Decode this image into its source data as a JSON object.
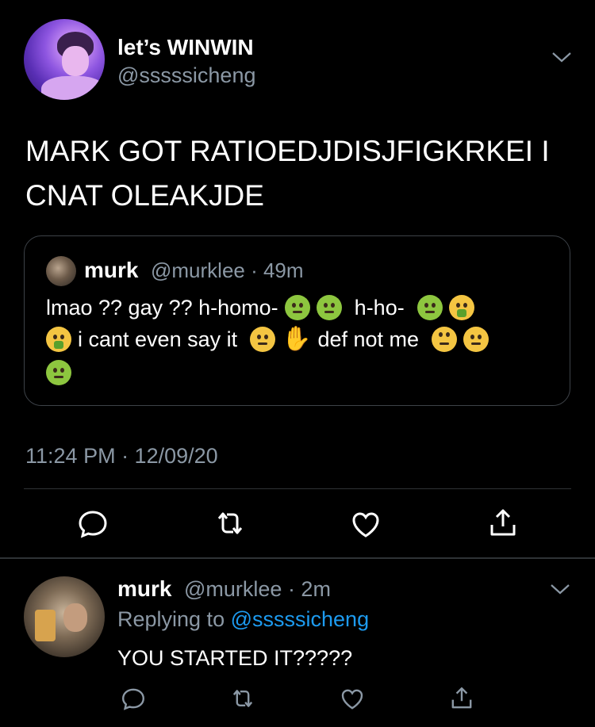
{
  "main_tweet": {
    "display_name": "let’s WINWIN",
    "handle": "@sssssicheng",
    "text": "MARK GOT RATIOEDJDISJFIGKRKEI I CNAT OLEAKJDE",
    "timestamp": "11:24 PM · 12/09/20"
  },
  "quoted_tweet": {
    "display_name": "murk",
    "handle_time": "@murklee · 49m",
    "line1_a": "lmao ?? gay ?? h-homo-",
    "line1_b": "h-ho-",
    "line2_a": "i cant even say it",
    "line2_b": "def not me",
    "emojis": [
      "nauseated-face",
      "nauseated-face",
      "nauseated-face",
      "face-vomiting",
      "face-vomiting",
      "neutral-face",
      "raised-hand",
      "face-with-rolling-eyes",
      "face-with-raised-eyebrow",
      "nauseated-face"
    ]
  },
  "reply_tweet": {
    "display_name": "murk",
    "handle_time": "@murklee · 2m",
    "replying_prefix": "Replying to",
    "replying_mention": "@sssssicheng",
    "text": "YOU STARTED IT?????"
  },
  "actions": [
    "reply-icon",
    "retweet-icon",
    "like-icon",
    "share-icon"
  ],
  "colors": {
    "background": "#000000",
    "secondary_text": "#8b98a5",
    "link": "#1d9bf0",
    "divider": "#2f3336"
  }
}
